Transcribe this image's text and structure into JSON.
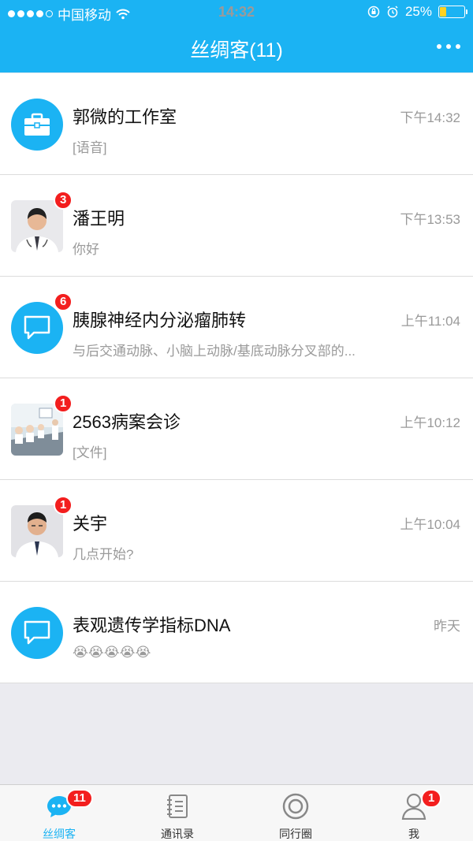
{
  "status": {
    "carrier": "中国移动",
    "time": "14:32",
    "battery": "25%",
    "battery_level": 0.25
  },
  "header": {
    "title": "丝绸客(11)",
    "more_icon": "ellipsis-icon"
  },
  "conversations": [
    {
      "name": "郭微的工作室",
      "preview": "[语音]",
      "time": "下午14:32",
      "badge": "",
      "avatar": "briefcase-icon"
    },
    {
      "name": "潘王明",
      "preview": "你好",
      "time": "下午13:53",
      "badge": "3",
      "avatar": "doctor-photo"
    },
    {
      "name": "胰腺神经内分泌瘤肺转",
      "preview": "与后交通动脉、小脑上动脉/基底动脉分叉部的...",
      "time": "上午11:04",
      "badge": "6",
      "avatar": "chat-bubble-icon"
    },
    {
      "name": "2563病案会诊",
      "preview": "[文件]",
      "time": "上午10:12",
      "badge": "1",
      "avatar": "meeting-photo"
    },
    {
      "name": "关宇",
      "preview": "几点开始?",
      "time": "上午10:04",
      "badge": "1",
      "avatar": "doctor-photo"
    },
    {
      "name": "表观遗传学指标DNA",
      "preview": "😭😭😭😭😭",
      "time": "昨天",
      "badge": "",
      "avatar": "chat-bubble-icon"
    }
  ],
  "tabs": [
    {
      "label": "丝绸客",
      "badge": "11",
      "icon": "chat-icon"
    },
    {
      "label": "通讯录",
      "badge": "",
      "icon": "contacts-icon"
    },
    {
      "label": "同行圈",
      "badge": "",
      "icon": "circle-icon"
    },
    {
      "label": "我",
      "badge": "1",
      "icon": "person-icon"
    }
  ],
  "colors": {
    "accent": "#1bb3f3",
    "badge": "#f31e1e"
  }
}
